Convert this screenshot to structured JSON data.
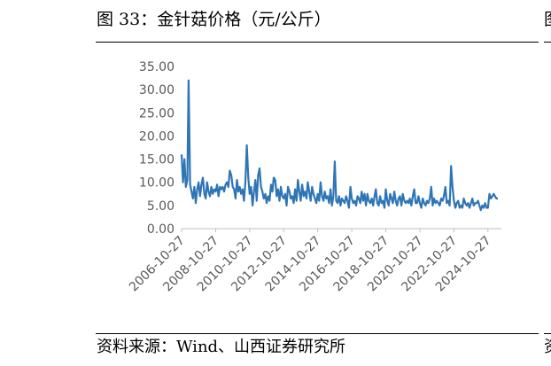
{
  "figure": {
    "title": "图 33：金针菇价格（元/公斤）",
    "source": "资料来源：Wind、山西证券研究所",
    "right_title_fragment": "图",
    "right_source_fragment": "资"
  },
  "chart_data": {
    "type": "line",
    "title": "",
    "xlabel": "",
    "ylabel": "",
    "ylim": [
      0,
      35
    ],
    "yticks": [
      "0.00",
      "5.00",
      "10.00",
      "15.00",
      "20.00",
      "25.00",
      "30.00",
      "35.00"
    ],
    "xticks": [
      "2006-10-27",
      "2008-10-27",
      "2010-10-27",
      "2012-10-27",
      "2014-10-27",
      "2016-10-27",
      "2018-10-27",
      "2020-10-27",
      "2022-10-27",
      "2024-10-27"
    ],
    "grid": false,
    "legend": "none",
    "series_color": "#2e75b6",
    "x": [
      "2006-10-27",
      "2006-11-27",
      "2006-12-27",
      "2007-01-27",
      "2007-02-27",
      "2007-03-27",
      "2007-04-27",
      "2007-05-27",
      "2007-06-27",
      "2007-07-27",
      "2007-08-27",
      "2007-09-27",
      "2007-10-27",
      "2007-11-27",
      "2007-12-27",
      "2008-01-27",
      "2008-02-27",
      "2008-03-27",
      "2008-04-27",
      "2008-05-27",
      "2008-06-27",
      "2008-07-27",
      "2008-08-27",
      "2008-09-27",
      "2008-10-27",
      "2008-11-27",
      "2008-12-27",
      "2009-01-27",
      "2009-02-27",
      "2009-03-27",
      "2009-04-27",
      "2009-05-27",
      "2009-06-27",
      "2009-07-27",
      "2009-08-27",
      "2009-09-27",
      "2009-10-27",
      "2009-11-27",
      "2009-12-27",
      "2010-01-27",
      "2010-02-27",
      "2010-03-27",
      "2010-04-27",
      "2010-05-27",
      "2010-06-27",
      "2010-07-27",
      "2010-08-27",
      "2010-09-27",
      "2010-10-27",
      "2010-11-27",
      "2010-12-27",
      "2011-01-27",
      "2011-02-27",
      "2011-03-27",
      "2011-04-27",
      "2011-05-27",
      "2011-06-27",
      "2011-07-27",
      "2011-08-27",
      "2011-09-27",
      "2011-10-27",
      "2011-11-27",
      "2011-12-27",
      "2012-01-27",
      "2012-02-27",
      "2012-03-27",
      "2012-04-27",
      "2012-05-27",
      "2012-06-27",
      "2012-07-27",
      "2012-08-27",
      "2012-09-27",
      "2012-10-27",
      "2012-11-27",
      "2012-12-27",
      "2013-01-27",
      "2013-02-27",
      "2013-03-27",
      "2013-04-27",
      "2013-05-27",
      "2013-06-27",
      "2013-07-27",
      "2013-08-27",
      "2013-09-27",
      "2013-10-27",
      "2013-11-27",
      "2013-12-27",
      "2014-01-27",
      "2014-02-27",
      "2014-03-27",
      "2014-04-27",
      "2014-05-27",
      "2014-06-27",
      "2014-07-27",
      "2014-08-27",
      "2014-09-27",
      "2014-10-27",
      "2014-11-27",
      "2014-12-27",
      "2015-01-27",
      "2015-02-27",
      "2015-03-27",
      "2015-04-27",
      "2015-05-27",
      "2015-06-27",
      "2015-07-27",
      "2015-08-27",
      "2015-09-27",
      "2015-10-27",
      "2015-11-27",
      "2015-12-27",
      "2016-01-27",
      "2016-02-27",
      "2016-03-27",
      "2016-04-27",
      "2016-05-27",
      "2016-06-27",
      "2016-07-27",
      "2016-08-27",
      "2016-09-27",
      "2016-10-27",
      "2016-11-27",
      "2016-12-27",
      "2017-01-27",
      "2017-02-27",
      "2017-03-27",
      "2017-04-27",
      "2017-05-27",
      "2017-06-27",
      "2017-07-27",
      "2017-08-27",
      "2017-09-27",
      "2017-10-27",
      "2017-11-27",
      "2017-12-27",
      "2018-01-27",
      "2018-02-27",
      "2018-03-27",
      "2018-04-27",
      "2018-05-27",
      "2018-06-27",
      "2018-07-27",
      "2018-08-27",
      "2018-09-27",
      "2018-10-27",
      "2018-11-27",
      "2018-12-27",
      "2019-01-27",
      "2019-02-27",
      "2019-03-27",
      "2019-04-27",
      "2019-05-27",
      "2019-06-27",
      "2019-07-27",
      "2019-08-27",
      "2019-09-27",
      "2019-10-27",
      "2019-11-27",
      "2019-12-27",
      "2020-01-27",
      "2020-02-27",
      "2020-03-27",
      "2020-04-27",
      "2020-05-27",
      "2020-06-27",
      "2020-07-27",
      "2020-08-27",
      "2020-09-27",
      "2020-10-27",
      "2020-11-27",
      "2020-12-27",
      "2021-01-27",
      "2021-02-27",
      "2021-03-27",
      "2021-04-27",
      "2021-05-27",
      "2021-06-27",
      "2021-07-27",
      "2021-08-27",
      "2021-09-27",
      "2021-10-27",
      "2021-11-27",
      "2021-12-27",
      "2022-01-27",
      "2022-02-27",
      "2022-03-27",
      "2022-04-27",
      "2022-05-27",
      "2022-06-27",
      "2022-07-27",
      "2022-08-27",
      "2022-09-27",
      "2022-10-27",
      "2022-11-27",
      "2022-12-27",
      "2023-01-27",
      "2023-02-27",
      "2023-03-27",
      "2023-04-27",
      "2023-05-27",
      "2023-06-27",
      "2023-07-27",
      "2023-08-27",
      "2023-09-27",
      "2023-10-27",
      "2023-11-27",
      "2023-12-27",
      "2024-01-27",
      "2024-02-27",
      "2024-03-27",
      "2024-04-27",
      "2024-05-27",
      "2024-06-27",
      "2024-07-27",
      "2024-08-27",
      "2024-09-27",
      "2024-10-27",
      "2024-11-27",
      "2024-12-27",
      "2025-01-27",
      "2025-02-27",
      "2025-03-27",
      "2025-04-27",
      "2025-05-27"
    ],
    "y": [
      16.0,
      10.0,
      15.0,
      9.0,
      10.5,
      32.0,
      9.5,
      8.0,
      6.5,
      9.0,
      5.5,
      8.5,
      10.0,
      7.0,
      9.5,
      11.0,
      7.5,
      6.5,
      10.0,
      8.0,
      7.0,
      9.0,
      7.5,
      8.5,
      8.0,
      9.5,
      7.0,
      9.0,
      8.5,
      9.0,
      8.0,
      9.5,
      10.0,
      9.0,
      12.5,
      11.5,
      9.0,
      8.5,
      6.5,
      10.5,
      8.0,
      9.0,
      7.5,
      8.5,
      6.0,
      10.0,
      18.0,
      11.0,
      7.5,
      9.0,
      5.0,
      8.0,
      10.5,
      6.0,
      11.5,
      13.0,
      9.0,
      8.0,
      6.5,
      7.5,
      5.5,
      7.0,
      6.0,
      9.5,
      8.0,
      11.0,
      10.5,
      7.0,
      8.5,
      6.0,
      9.0,
      7.0,
      6.5,
      7.5,
      5.0,
      9.0,
      8.0,
      6.5,
      7.0,
      5.5,
      8.5,
      6.0,
      10.5,
      8.0,
      6.0,
      9.5,
      7.0,
      8.0,
      6.5,
      10.0,
      8.0,
      6.0,
      9.0,
      7.5,
      6.5,
      5.5,
      7.5,
      6.0,
      10.0,
      7.0,
      6.0,
      8.0,
      6.5,
      7.0,
      5.5,
      8.5,
      5.0,
      7.0,
      14.5,
      6.0,
      5.5,
      7.0,
      5.0,
      6.5,
      6.0,
      5.5,
      7.0,
      6.0,
      4.5,
      9.0,
      6.5,
      5.5,
      6.0,
      5.0,
      7.0,
      6.5,
      5.5,
      8.0,
      6.0,
      7.5,
      5.0,
      7.5,
      6.0,
      5.5,
      6.5,
      5.0,
      7.0,
      8.5,
      5.5,
      5.0,
      7.0,
      5.5,
      6.0,
      4.5,
      8.5,
      6.0,
      5.0,
      7.5,
      6.5,
      5.5,
      8.0,
      6.0,
      5.0,
      6.5,
      7.0,
      5.0,
      7.5,
      6.0,
      5.5,
      6.0,
      5.5,
      6.5,
      5.0,
      7.0,
      8.5,
      5.5,
      5.5,
      7.0,
      5.5,
      4.5,
      6.5,
      5.5,
      5.0,
      6.0,
      5.5,
      6.5,
      9.0,
      5.0,
      6.5,
      5.5,
      6.0,
      5.5,
      5.0,
      6.5,
      6.0,
      7.0,
      9.0,
      5.5,
      6.0,
      5.0,
      13.5,
      9.0,
      6.0,
      4.5,
      5.5,
      6.0,
      4.5,
      5.0,
      4.5,
      6.5,
      5.5,
      5.0,
      5.5,
      4.5,
      5.5,
      6.5,
      5.0,
      5.5,
      5.5,
      6.0,
      5.0,
      4.0,
      5.0,
      4.5,
      5.5,
      4.5,
      4.5,
      7.5,
      6.5,
      7.0,
      7.5,
      7.0,
      6.5,
      6.5
    ]
  }
}
